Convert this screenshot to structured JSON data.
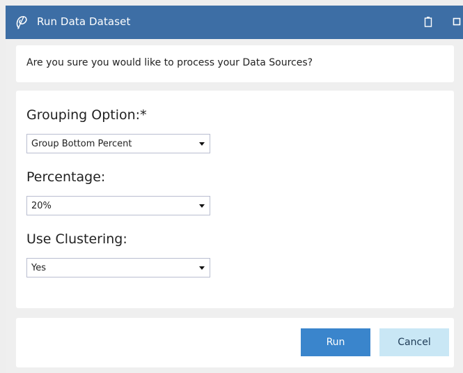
{
  "window": {
    "title": "Run Data Dataset",
    "logo_icon": "swirl-logo-icon",
    "titlebar_color": "#3d6ea5"
  },
  "question": {
    "text": "Are you sure you would like to process your Data Sources?"
  },
  "form": {
    "grouping_label": "Grouping Option:*",
    "grouping_value": "Group Bottom Percent",
    "percentage_label": "Percentage:",
    "percentage_value": "20%",
    "clustering_label": "Use Clustering:",
    "clustering_value": "Yes"
  },
  "footer": {
    "run_label": "Run",
    "cancel_label": "Cancel",
    "run_color": "#3a85cc",
    "cancel_color": "#c9e7f5"
  }
}
